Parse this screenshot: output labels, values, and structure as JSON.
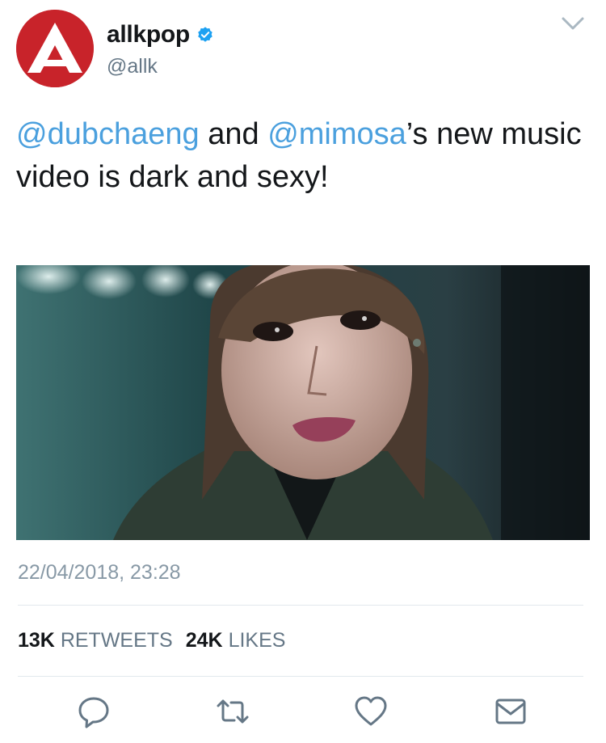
{
  "user": {
    "display_name": "allkpop",
    "handle": "@allk",
    "verified": true,
    "avatar_icon": "allkpop-logo-icon",
    "brand_color": "#c8232a"
  },
  "tweet": {
    "mention1": "@dubchaeng",
    "text1": " and ",
    "mention2": "@mimosa",
    "text2": "’s new music video is dark and sexy!",
    "timestamp": "22/04/2018, 23:28",
    "mention_color": "#4ba0de"
  },
  "stats": {
    "retweets_count": "13K",
    "retweets_label": "RETWEETS",
    "likes_count": "24K",
    "likes_label": "LIKES"
  },
  "actions": [
    {
      "name": "reply",
      "icon": "reply-icon"
    },
    {
      "name": "retweet",
      "icon": "retweet-icon"
    },
    {
      "name": "like",
      "icon": "heart-icon"
    },
    {
      "name": "share",
      "icon": "mail-icon"
    }
  ],
  "menu": {
    "icon": "chevron-down-icon"
  }
}
